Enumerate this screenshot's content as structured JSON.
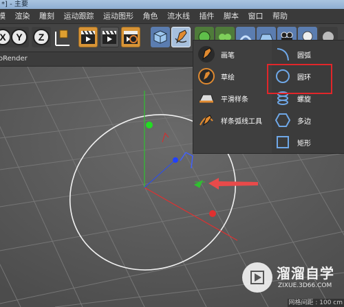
{
  "window": {
    "title": "*] - 主要"
  },
  "menubar": {
    "items": [
      "模",
      "渲染",
      "雕刻",
      "运动跟踪",
      "运动图形",
      "角色",
      "流水线",
      "插件",
      "脚本",
      "窗口",
      "帮助"
    ]
  },
  "toolbar": {
    "axis_locks": [
      "X",
      "Y",
      "Z"
    ]
  },
  "subbar": {
    "label": "oRender"
  },
  "spline_menu": {
    "left_items": [
      "画笔",
      "草绘",
      "平滑样条",
      "样条弧线工具"
    ],
    "right_items": [
      "圆弧",
      "圆环",
      "螺旋",
      "多边",
      "矩形"
    ]
  },
  "status": {
    "text": "网格间距 : 100 cm"
  },
  "watermark": {
    "brand": "溜溜自学",
    "url": "ZIXUE.3D66.COM"
  },
  "colors": {
    "highlight": "#e2262a",
    "arrow": "#e84a4a",
    "x_axis": "#e03030",
    "y_axis": "#30c030",
    "z_axis": "#3050e0"
  }
}
